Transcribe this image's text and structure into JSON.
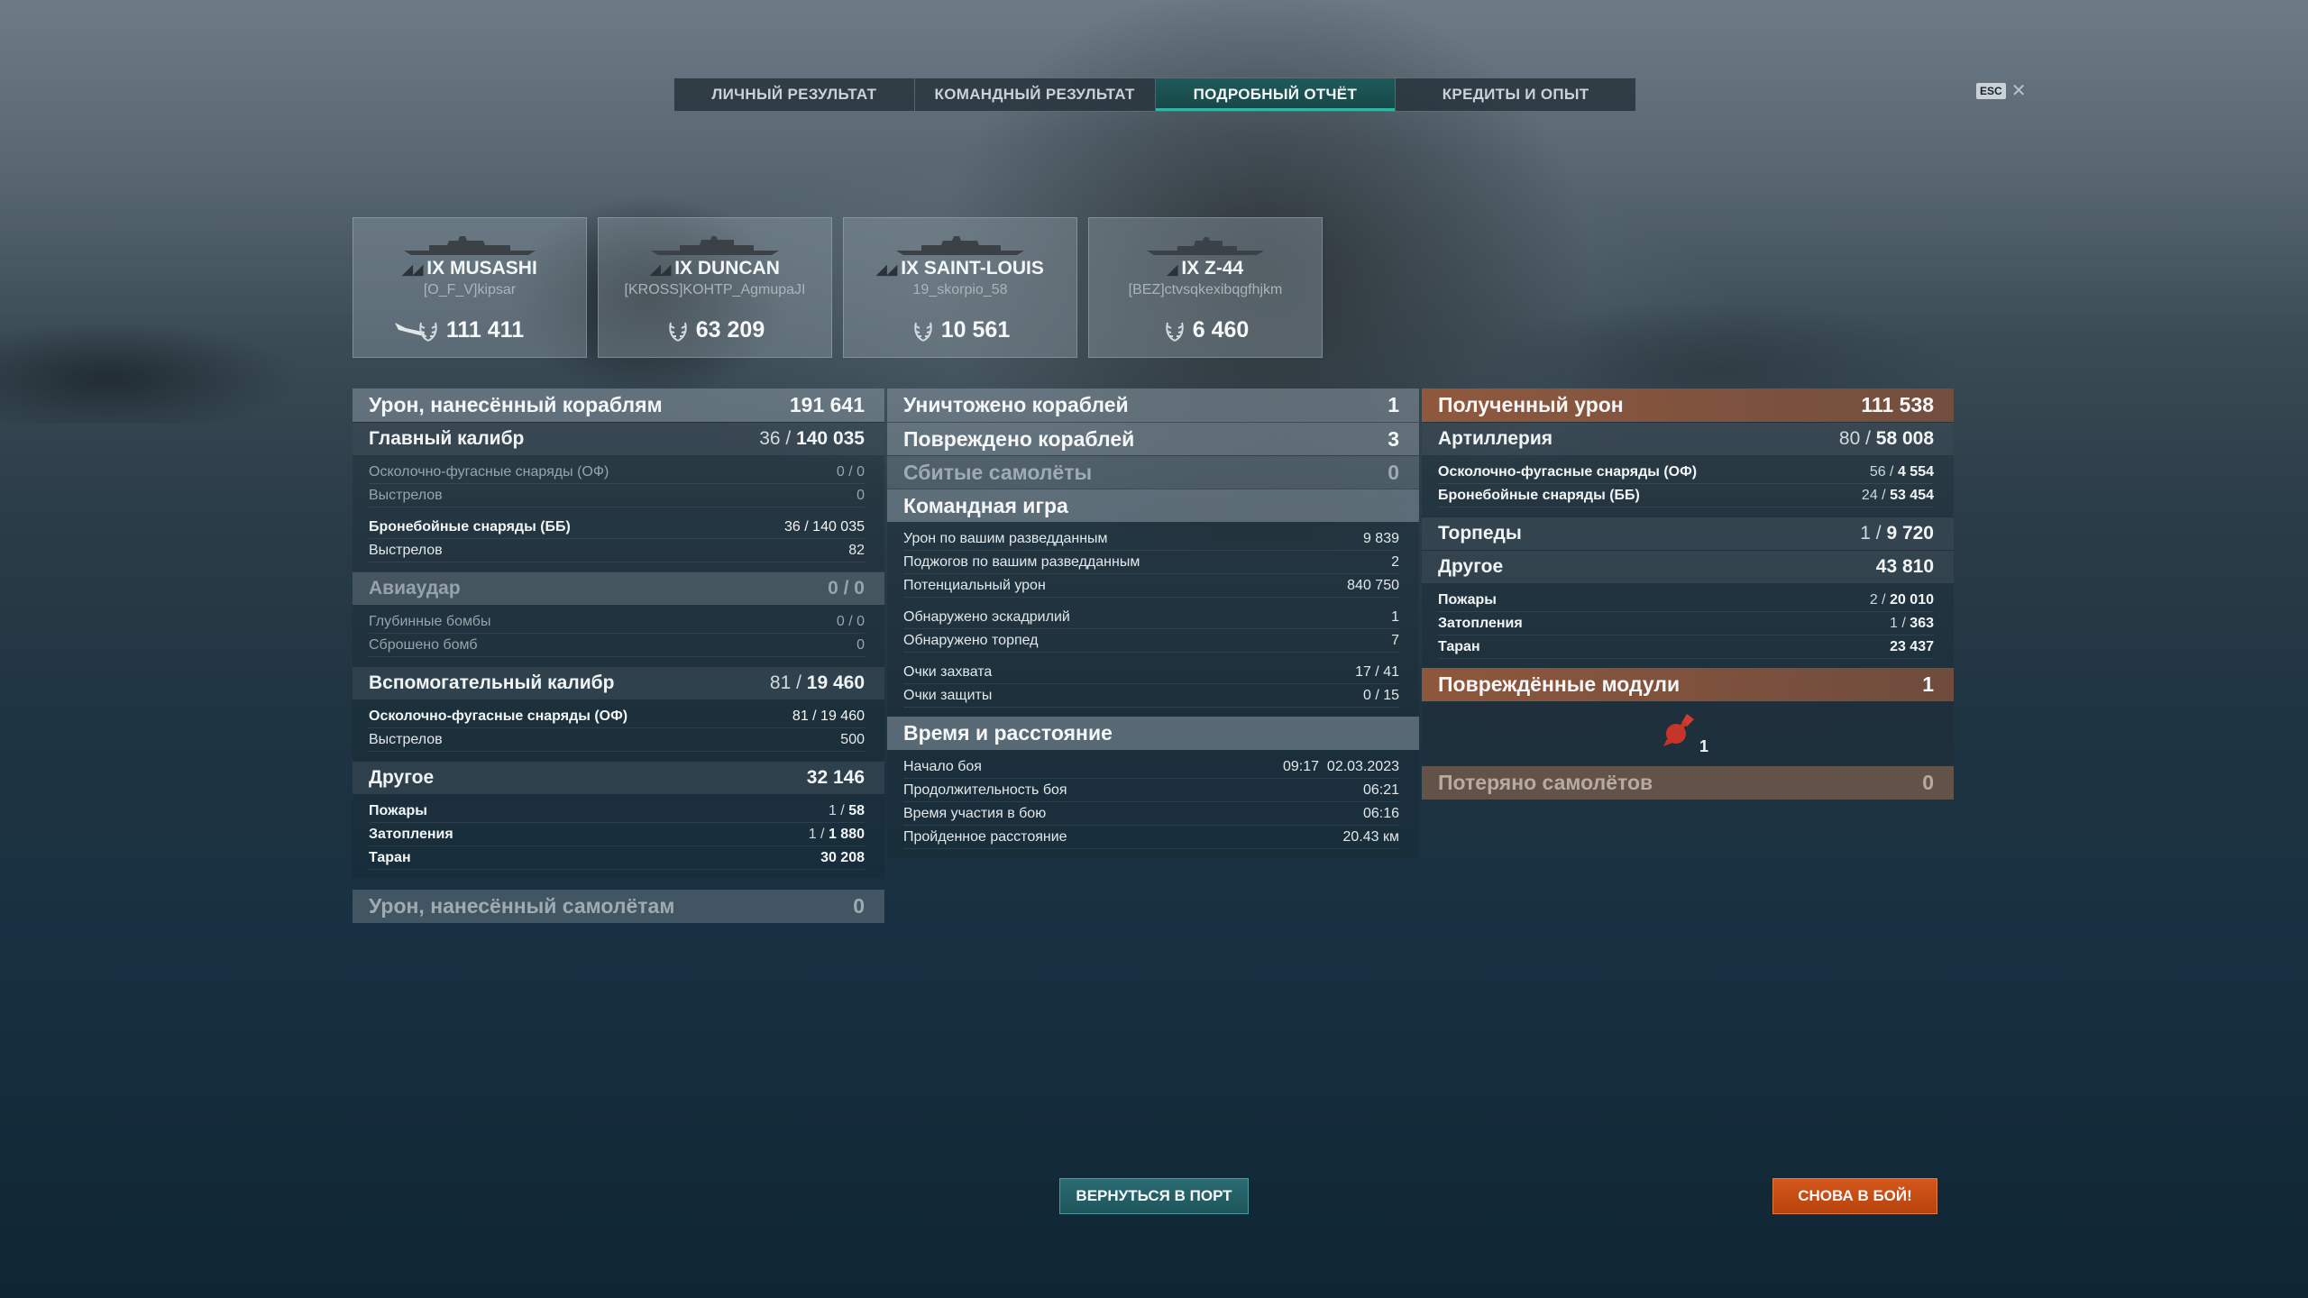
{
  "tabs": [
    "ЛИЧНЫЙ РЕЗУЛЬТАТ",
    "КОМАНДНЫЙ РЕЗУЛЬТАТ",
    "ПОДРОБНЫЙ ОТЧЁТ",
    "КРЕДИТЫ И ОПЫТ"
  ],
  "active_tab": "ПОДРОБНЫЙ ОТЧЁТ",
  "esc": {
    "key": "ESC",
    "close": "✕"
  },
  "ships": [
    {
      "tier_name": "IX MUSASHI",
      "player": "[O_F_V]kipsar",
      "damage": "111 411"
    },
    {
      "tier_name": "IX DUNCAN",
      "player": "[KROSS]KOHTP_AgmupaJI",
      "damage": "63 209"
    },
    {
      "tier_name": "IX SAINT-LOUIS",
      "player": "19_skorpio_58",
      "damage": "10 561"
    },
    {
      "tier_name": "IX Z-44",
      "player": "[BEZ]ctvsqkexibqgfhjkm",
      "damage": "6 460"
    }
  ],
  "col1": {
    "ship_damage": {
      "label": "Урон, нанесённый кораблям",
      "value": "191 641"
    },
    "main_battery": {
      "label": "Главный калибр",
      "hits": "36",
      "damage": "140 035"
    },
    "he_label": "Осколочно-фугасные снаряды (ОФ)",
    "he_value": "0 / 0",
    "he_shots_label": "Выстрелов",
    "he_shots": "0",
    "ap_label": "Бронебойные снаряды (ББ)",
    "ap_value": "36 / 140 035",
    "ap_shots_label": "Выстрелов",
    "ap_shots": "82",
    "airstrike": {
      "label": "Авиаудар",
      "value": "0 / 0"
    },
    "depth_label": "Глубинные бомбы",
    "depth_value": "0 / 0",
    "bombs_label": "Сброшено бомб",
    "bombs_value": "0",
    "secondary": {
      "label": "Вспомогательный калибр",
      "hits": "81",
      "damage": "19 460"
    },
    "sec_he_label": "Осколочно-фугасные снаряды (ОФ)",
    "sec_he_value": "81 / 19 460",
    "sec_shots_label": "Выстрелов",
    "sec_shots": "500",
    "other": {
      "label": "Другое",
      "value": "32 146"
    },
    "fires_label": "Пожары",
    "fires_count": "1",
    "fires_dmg": "58",
    "flood_label": "Затопления",
    "flood_count": "1",
    "flood_dmg": "1 880",
    "ram_label": "Таран",
    "ram_dmg": "30 208",
    "plane_damage": {
      "label": "Урон, нанесённый самолётам",
      "value": "0"
    }
  },
  "col2": {
    "destroyed": {
      "label": "Уничтожено кораблей",
      "value": "1"
    },
    "damaged": {
      "label": "Повреждено кораблей",
      "value": "3"
    },
    "planes": {
      "label": "Сбитые самолёты",
      "value": "0"
    },
    "team": {
      "label": "Командная игра"
    },
    "spot_dmg_label": "Урон по вашим разведданным",
    "spot_dmg": "9 839",
    "spot_fire_label": "Поджогов по вашим разведданным",
    "spot_fire": "2",
    "potential_label": "Потенциальный урон",
    "potential": "840 750",
    "squad_label": "Обнаружено эскадрилий",
    "squad": "1",
    "torp_label": "Обнаружено торпед",
    "torp": "7",
    "cap_label": "Очки захвата",
    "cap": "17 / 41",
    "def_label": "Очки защиты",
    "def": "0 / 15",
    "time": {
      "label": "Время и расстояние"
    },
    "start_label": "Начало боя",
    "start": "09:17  02.03.2023",
    "dur_label": "Продолжительность боя",
    "dur": "06:21",
    "part_label": "Время участия в бою",
    "part": "06:16",
    "dist_label": "Пройденное расстояние",
    "dist": "20.43 км"
  },
  "col3": {
    "received": {
      "label": "Полученный урон",
      "value": "111 538"
    },
    "artillery": {
      "label": "Артиллерия",
      "hits": "80",
      "damage": "58 008"
    },
    "he_label": "Осколочно-фугасные снаряды (ОФ)",
    "he_hits": "56",
    "he_dmg": "4 554",
    "ap_label": "Бронебойные снаряды (ББ)",
    "ap_hits": "24",
    "ap_dmg": "53 454",
    "torpedoes": {
      "label": "Торпеды",
      "hits": "1",
      "damage": "9 720"
    },
    "other": {
      "label": "Другое",
      "value": "43 810"
    },
    "fires_label": "Пожары",
    "fires_count": "2",
    "fires_dmg": "20 010",
    "flood_label": "Затопления",
    "flood_count": "1",
    "flood_dmg": "363",
    "ram_label": "Таран",
    "ram_dmg": "23 437",
    "modules": {
      "label": "Повреждённые модули",
      "value": "1",
      "icon_count": "1"
    },
    "lost_planes": {
      "label": "Потеряно самолётов",
      "value": "0"
    }
  },
  "buttons": {
    "port": "ВЕРНУТЬСЯ В ПОРТ",
    "battle": "СНОВА В БОЙ!"
  }
}
